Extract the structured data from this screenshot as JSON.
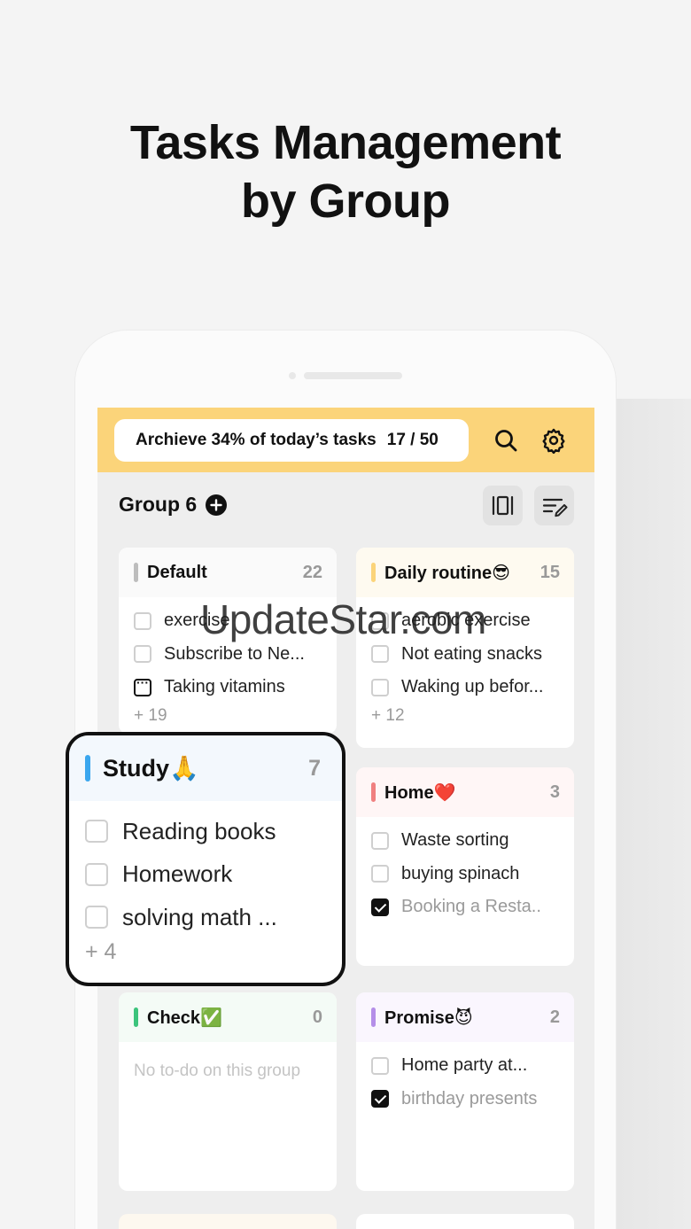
{
  "headline": {
    "line1": "Tasks Management",
    "line2": "by Group"
  },
  "topbar": {
    "progress_text": "Archieve 34% of today’s tasks",
    "progress_count": "17 / 50",
    "search_icon": "search-icon",
    "settings_icon": "gear-icon",
    "accent": "#fbd47a"
  },
  "group": {
    "title": "Group 6"
  },
  "cards": {
    "default": {
      "name": "Default",
      "count": "22",
      "color": "#bdbdbd",
      "tasks": [
        "exercise",
        "Subscribe to Ne...",
        "Taking vitamins"
      ],
      "more": "+ 19"
    },
    "daily": {
      "name": "Daily routine😎",
      "count": "15",
      "color": "#fbd47a",
      "tasks": [
        "aerobic exercise",
        "Not eating snacks",
        "Waking up befor..."
      ],
      "more": "+ 12"
    },
    "study": {
      "name": "Study🙏",
      "count": "7",
      "color": "#3aa6ee",
      "tasks": [
        "Reading books",
        "Homework",
        "solving math ..."
      ],
      "more": "+ 4"
    },
    "home": {
      "name": "Home❤️",
      "count": "3",
      "color": "#f08080",
      "tasks": [
        "Waste sorting",
        "buying spinach",
        "Booking a Resta.."
      ]
    },
    "check": {
      "name": "Check✅",
      "count": "0",
      "color": "#3cc47c",
      "empty": "No to-do on this group"
    },
    "promise": {
      "name": "Promise😈",
      "count": "2",
      "color": "#b48ee8",
      "tasks": [
        "Home party at...",
        "birthday presents"
      ]
    }
  },
  "watermark": "UpdateStar.com"
}
